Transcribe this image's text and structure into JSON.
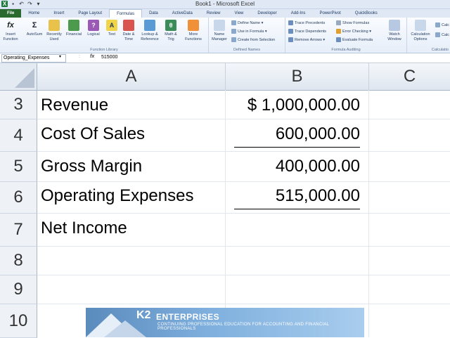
{
  "window": {
    "title": "Book1 - Microsoft Excel",
    "app_icon": "excel-icon"
  },
  "ribbon_tabs": [
    "File",
    "Home",
    "Insert",
    "Page Layout",
    "Formulas",
    "Data",
    "ActiveData",
    "Review",
    "View",
    "Developer",
    "Add-Ins",
    "PowerPivot",
    "QuickBooks"
  ],
  "active_tab": "Formulas",
  "ribbon": {
    "function_library": {
      "label": "Function Library",
      "buttons": [
        "Insert Function",
        "AutoSum",
        "Recently Used",
        "Financial",
        "Logical",
        "Text",
        "Date & Time",
        "Lookup & Reference",
        "Math & Trig",
        "More Functions"
      ]
    },
    "defined_names": {
      "label": "Defined Names",
      "name_manager": "Name Manager",
      "define_name": "Define Name",
      "use_in_formula": "Use in Formula",
      "create_from_selection": "Create from Selection"
    },
    "formula_auditing": {
      "label": "Formula Auditing",
      "trace_precedents": "Trace Precedents",
      "trace_dependents": "Trace Dependents",
      "remove_arrows": "Remove Arrows",
      "show_formulas": "Show Formulas",
      "error_checking": "Error Checking",
      "evaluate_formula": "Evaluate Formula",
      "watch_window": "Watch Window"
    },
    "calculation": {
      "label": "Calculatio",
      "calculation_options": "Calculation Options",
      "calc_now": "Calc",
      "calc_sheet": "Calc"
    }
  },
  "formula_bar": {
    "name_box": "Operating_Expenses",
    "fx": "fx",
    "value": "515000"
  },
  "columns": [
    "A",
    "B",
    "C"
  ],
  "rows": [
    {
      "num": "3",
      "label": "Revenue",
      "value": "$ 1,000,000.00"
    },
    {
      "num": "4",
      "label": "Cost Of Sales",
      "value": "600,000.00"
    },
    {
      "num": "5",
      "label": "Gross Margin",
      "value": "400,000.00"
    },
    {
      "num": "6",
      "label": "Operating Expenses",
      "value": "515,000.00"
    },
    {
      "num": "7",
      "label": "Net Income",
      "value": ""
    },
    {
      "num": "8",
      "label": "",
      "value": ""
    },
    {
      "num": "9",
      "label": "",
      "value": ""
    },
    {
      "num": "10",
      "label": "",
      "value": ""
    }
  ],
  "banner": {
    "logo": "K2",
    "name": "ENTERPRISES",
    "tagline": "CONTINUING PROFESSIONAL EDUCATION FOR ACCOUNTING AND FINANCIAL PROFESSIONALS"
  }
}
